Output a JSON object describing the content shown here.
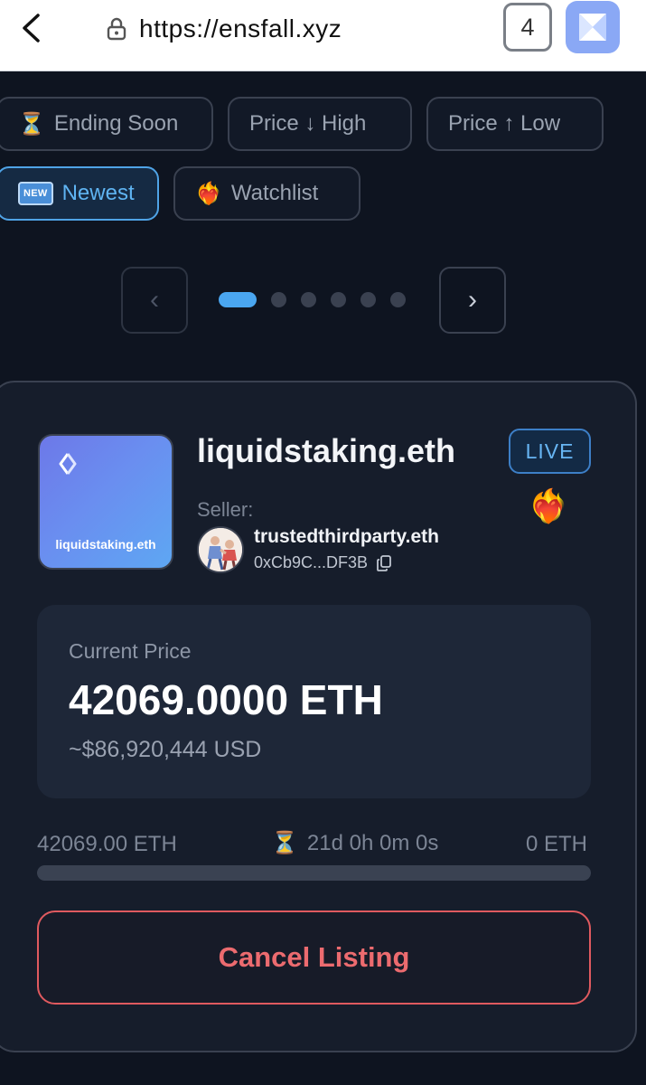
{
  "browser": {
    "url": "https://ensfall.xyz",
    "tab_count": "4",
    "icons": {
      "back": "chevron-left-icon",
      "lock": "lock-icon",
      "app": "app-logo-icon"
    }
  },
  "filters": [
    {
      "label": "Ending Soon",
      "icon": "hourglass-icon",
      "active": false
    },
    {
      "label": "Price ↓ High",
      "icon": null,
      "active": false
    },
    {
      "label": "Price ↑ Low",
      "icon": null,
      "active": false
    },
    {
      "label": "Newest",
      "icon": "new-badge-icon",
      "badge_text": "NEW",
      "active": true
    },
    {
      "label": "Watchlist",
      "icon": "heart-on-fire-icon",
      "active": false
    }
  ],
  "pager": {
    "prev": "‹",
    "next": "›",
    "total_pages": 6,
    "current_page": 1
  },
  "listing": {
    "name": "liquidstaking.eth",
    "thumbnail_label": "liquidstaking.eth",
    "status": "LIVE",
    "seller_label": "Seller:",
    "seller_name": "trustedthirdparty.eth",
    "seller_address": "0xCb9C...DF3B",
    "price_label": "Current Price",
    "price_eth": "42069.0000 ETH",
    "price_usd": "~$86,920,444 USD",
    "range_start": "42069.00 ETH",
    "time_remaining": "21d 0h 0m 0s",
    "range_end": "0 ETH",
    "progress_fraction": 0,
    "cancel_label": "Cancel Listing"
  },
  "colors": {
    "accent": "#4aa6f0",
    "background": "#0e1420",
    "card": "#161d2b",
    "danger": "#e05a5f"
  }
}
